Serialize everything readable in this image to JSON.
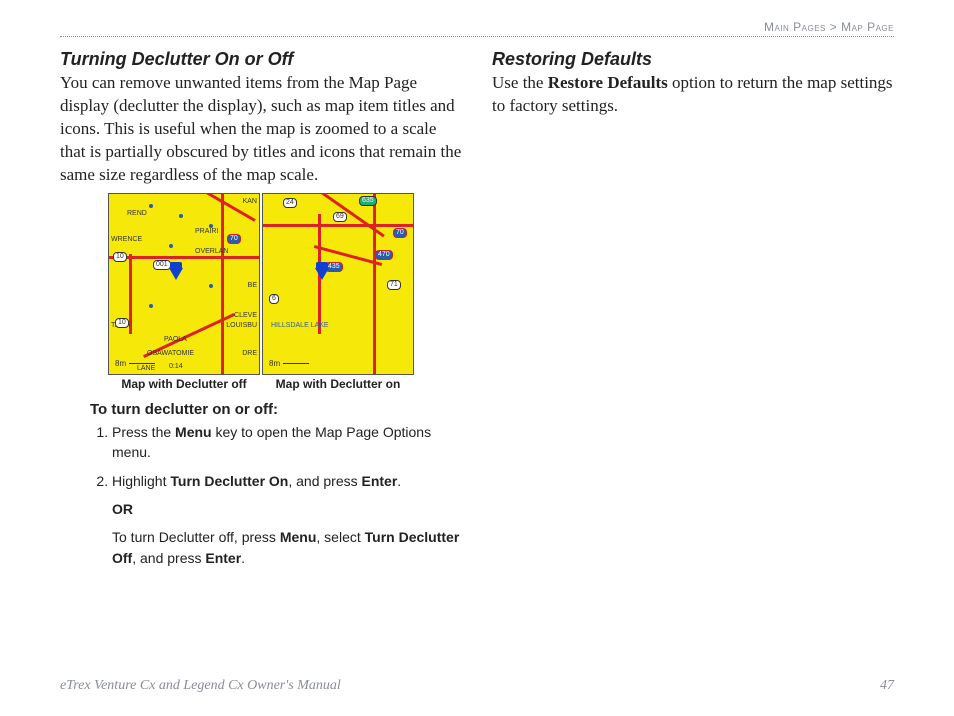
{
  "breadcrumb": {
    "section": "Main Pages",
    "sep": ">",
    "page": "Map Page"
  },
  "left": {
    "heading": "Turning Declutter On or Off",
    "intro": "You can remove unwanted items from the Map Page display (declutter the display), such as map item titles and icons. This is useful when the map is zoomed to a scale that is partially obscured by titles and icons that remain the same size regardless of the map scale.",
    "map_off_caption": "Map with Declutter off",
    "map_on_caption": "Map with Declutter on",
    "map_off_labels": {
      "rend": "REND",
      "wrence": "WRENCE",
      "prairi": "PRAIRI",
      "overlan": "OVERLAN",
      "be": "BE",
      "cleve": "CLEVE",
      "louisbu": "LOUISBU",
      "tawa": "TAWA",
      "paola": "PAOLA",
      "osawatomie": "OSAWATOMIE",
      "dre": "DRE",
      "lane": "LANE",
      "s10a": "10",
      "s10b": "10",
      "s70": "70",
      "s001": "001",
      "skan": "KAN",
      "scale": "8m",
      "time": "0:14"
    },
    "map_on_labels": {
      "hillsdale": "HILLSDALE LAKE",
      "s24": "24",
      "s635": "635",
      "s69": "69",
      "s70": "70",
      "s435": "435",
      "s470": "470",
      "s71": "71",
      "s6": "6",
      "scale": "8m"
    },
    "steps_heading": "To turn declutter on or off:",
    "step1_a": "Press the ",
    "step1_b": "Menu",
    "step1_c": " key to open the Map Page Options menu.",
    "step2_a": "Highlight ",
    "step2_b": "Turn Declutter On",
    "step2_c": ", and press ",
    "step2_d": "Enter",
    "step2_e": ".",
    "step2_or": "OR",
    "step2_f": "To turn Declutter off, press ",
    "step2_g": "Menu",
    "step2_h": ", select ",
    "step2_i": "Turn Declutter Off",
    "step2_j": ", and press ",
    "step2_k": "Enter",
    "step2_l": "."
  },
  "right": {
    "heading": "Restoring Defaults",
    "p_a": "Use the ",
    "p_b": "Restore Defaults",
    "p_c": " option to return the map settings to factory settings."
  },
  "footer": {
    "title": "eTrex Venture Cx and Legend Cx Owner's Manual",
    "page": "47"
  }
}
